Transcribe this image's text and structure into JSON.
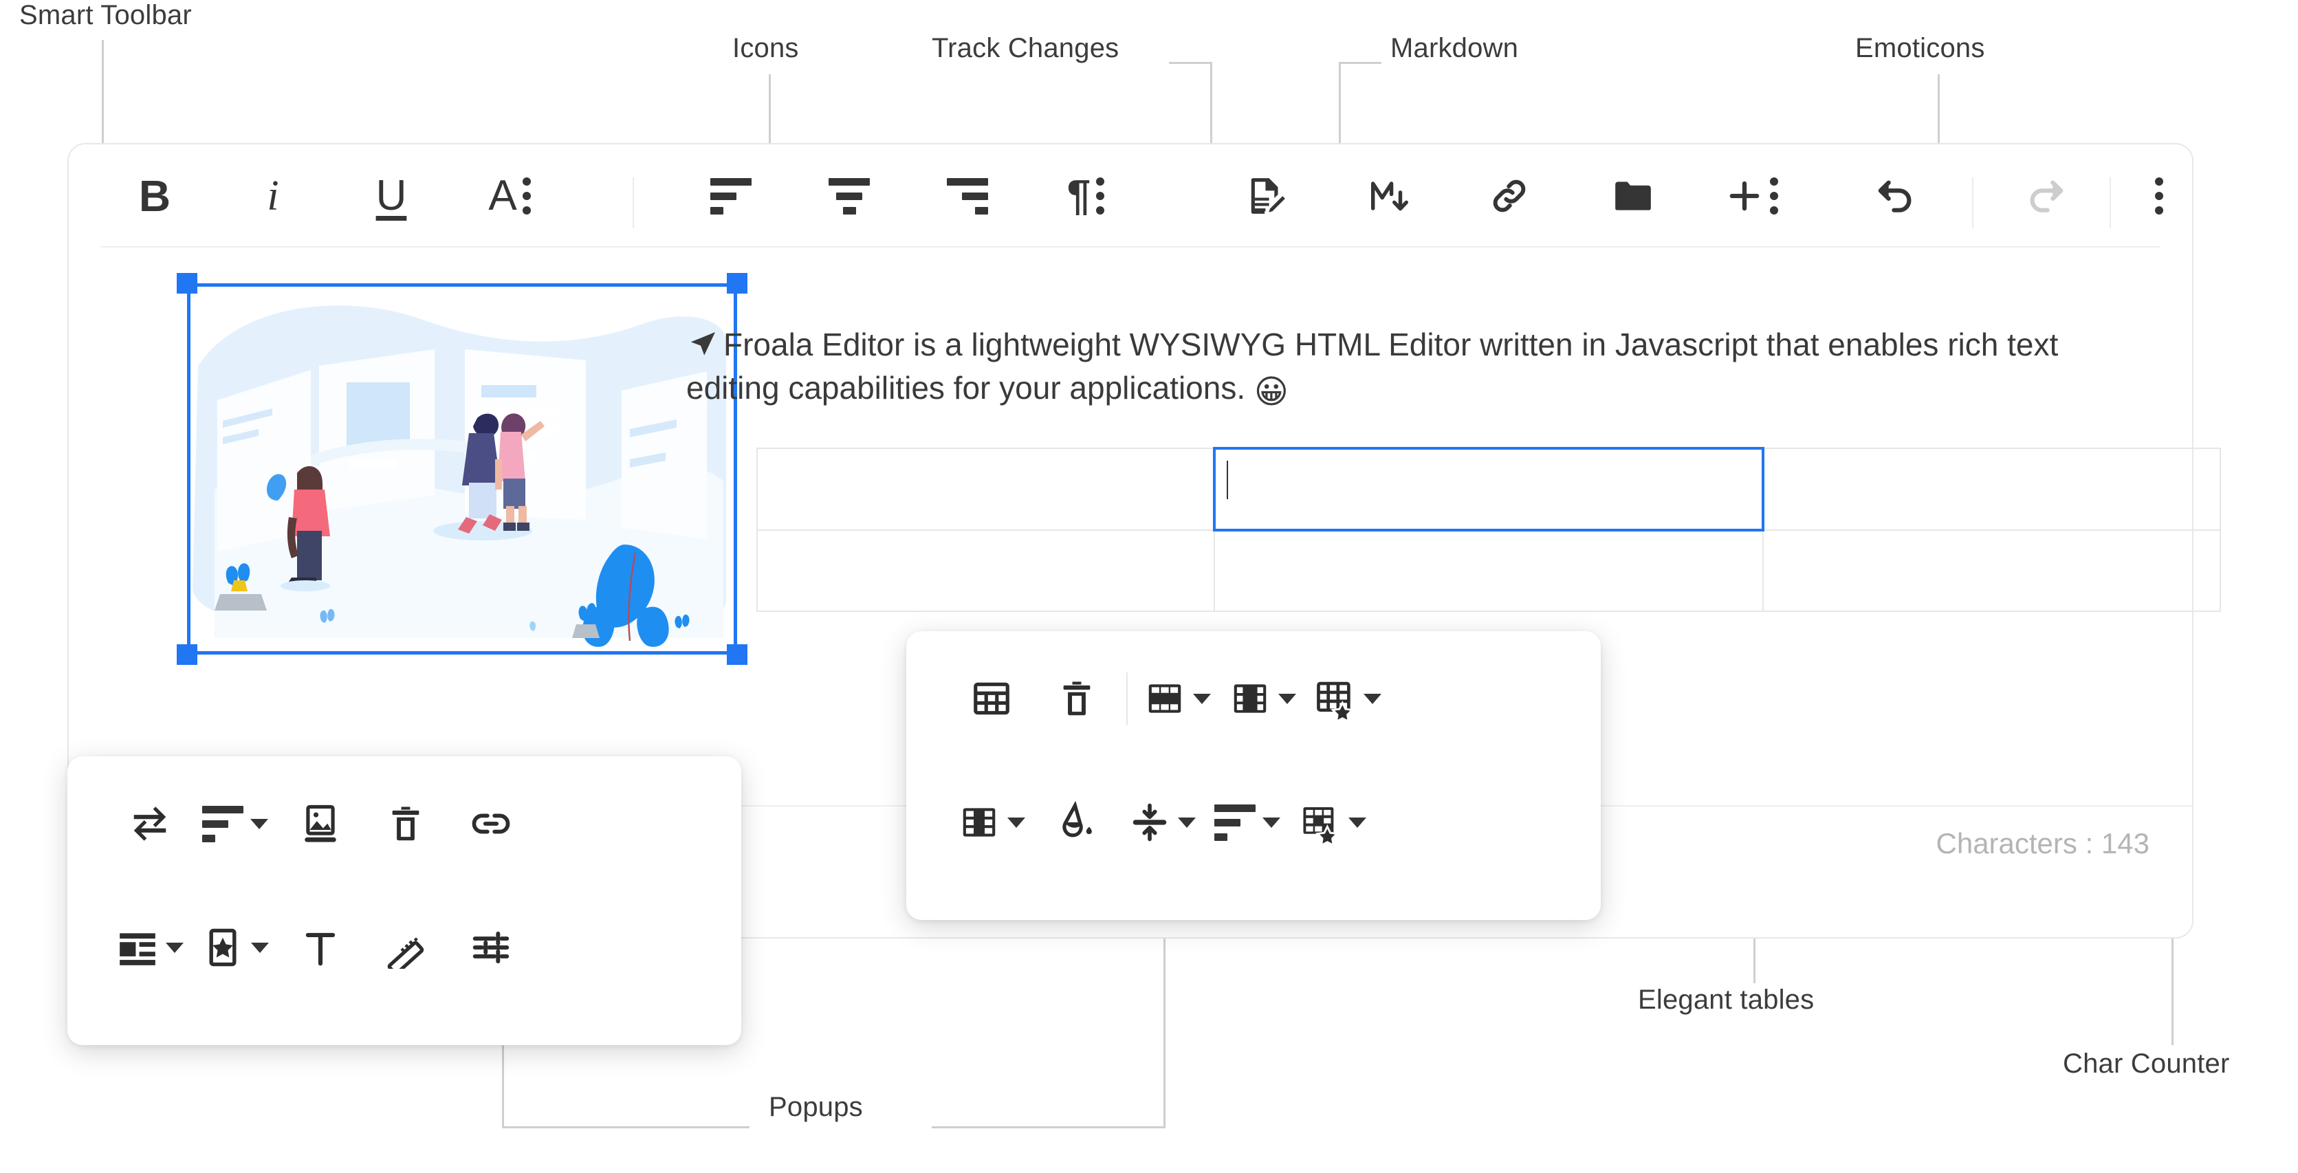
{
  "annotations": [
    {
      "id": "smart-toolbar",
      "label": "Smart Toolbar"
    },
    {
      "id": "icons",
      "label": "Icons"
    },
    {
      "id": "track-changes",
      "label": "Track Changes"
    },
    {
      "id": "markdown",
      "label": "Markdown"
    },
    {
      "id": "emoticons",
      "label": "Emoticons"
    },
    {
      "id": "popups",
      "label": "Popups"
    },
    {
      "id": "elegant-tables",
      "label": "Elegant tables"
    },
    {
      "id": "char-counter",
      "label": "Char Counter"
    }
  ],
  "toolbar": {
    "items": [
      {
        "name": "bold",
        "label": "B"
      },
      {
        "name": "italic",
        "label": "i"
      },
      {
        "name": "underline",
        "label": "U"
      },
      {
        "name": "more-text",
        "label": "A"
      },
      {
        "name": "align-left",
        "label": "Align Left"
      },
      {
        "name": "align-center",
        "label": "Align Center"
      },
      {
        "name": "align-right",
        "label": "Align Right"
      },
      {
        "name": "paragraph-format",
        "label": "¶"
      },
      {
        "name": "track-changes",
        "label": "Track Changes"
      },
      {
        "name": "markdown",
        "label": "M"
      },
      {
        "name": "insert-link",
        "label": "Insert Link"
      },
      {
        "name": "file-manager",
        "label": "Files"
      },
      {
        "name": "insert-more",
        "label": "Insert"
      },
      {
        "name": "undo",
        "label": "Undo"
      },
      {
        "name": "redo",
        "label": "Redo"
      },
      {
        "name": "more-misc",
        "label": "More"
      }
    ]
  },
  "document": {
    "paragraph_line1": "Froala Editor is a lightweight WYSIWYG HTML Editor written in Javascript that",
    "paragraph_line2": "enables rich text editing capabilities for your applications.",
    "emoji": "😀",
    "lead_icon": "cursor-arrow-icon"
  },
  "table": {
    "rows": 2,
    "cols": 3,
    "selected_cell": {
      "row": 0,
      "col": 1
    },
    "cells": [
      [
        "",
        "",
        ""
      ],
      [
        "",
        "",
        ""
      ]
    ]
  },
  "image_popup": {
    "row1": [
      {
        "name": "replace-image",
        "label": "Replace"
      },
      {
        "name": "image-align",
        "label": "Align",
        "caret": true
      },
      {
        "name": "image-display",
        "label": "Display"
      },
      {
        "name": "remove-image",
        "label": "Remove"
      },
      {
        "name": "image-link",
        "label": "Insert Link"
      }
    ],
    "row2": [
      {
        "name": "image-wrap",
        "label": "Wrap",
        "caret": true
      },
      {
        "name": "image-style",
        "label": "Style",
        "caret": true
      },
      {
        "name": "image-alt",
        "label": "Alternative Text"
      },
      {
        "name": "image-size",
        "label": "Change Size"
      },
      {
        "name": "image-adjust",
        "label": "Adjust"
      }
    ]
  },
  "table_popup": {
    "row1": [
      {
        "name": "insert-table",
        "label": "Insert Table"
      },
      {
        "name": "remove-table",
        "label": "Remove Table"
      },
      {
        "name": "table-rows",
        "label": "Row",
        "caret": true
      },
      {
        "name": "table-columns",
        "label": "Column",
        "caret": true
      },
      {
        "name": "table-style",
        "label": "Table Style",
        "caret": true
      }
    ],
    "row2": [
      {
        "name": "table-cells",
        "label": "Cell",
        "caret": true
      },
      {
        "name": "cell-background",
        "label": "Cell Background"
      },
      {
        "name": "cell-vertical-align",
        "label": "Vertical Align",
        "caret": true
      },
      {
        "name": "cell-horizontal-align",
        "label": "Horizontal Align",
        "caret": true
      },
      {
        "name": "cell-style",
        "label": "Cell Style",
        "caret": true
      }
    ]
  },
  "status": {
    "char_counter": "Characters : 143"
  },
  "colors": {
    "accent": "#2176f3",
    "icon": "#353535",
    "icon_disabled": "#cdcdcd",
    "border": "#e8e8e8",
    "anno_text": "#3c3c3c",
    "anno_line": "#cfcfcf",
    "counter_text": "#b4b4b4"
  }
}
